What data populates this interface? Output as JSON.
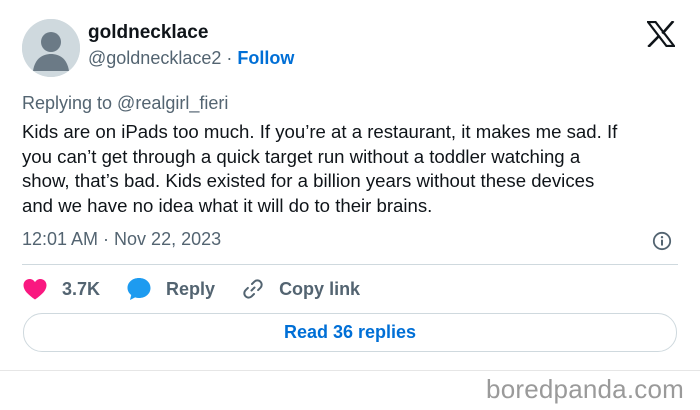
{
  "author": {
    "display_name": "goldnecklace",
    "handle": "@goldnecklace2",
    "separator": "·",
    "follow_label": "Follow"
  },
  "tweet": {
    "replying_to": "Replying to @realgirl_fieri",
    "text": "Kids are on iPads too much. If you’re at a restaurant, it makes me sad. If\nyou can’t get through a quick target run without a toddler watching a\nshow, that’s bad. Kids existed for a billion years without these devices\nand we have no idea what it will do to their brains.",
    "timestamp": "12:01 AM · Nov 22, 2023"
  },
  "actions": {
    "likes_count": "3.7K",
    "reply_label": "Reply",
    "copy_link_label": "Copy link",
    "read_replies_label": "Read 36 replies"
  },
  "icons": {
    "brand": "x-logo-icon",
    "info": "info-icon",
    "like": "heart-icon",
    "reply": "speech-bubble-icon",
    "copy": "link-icon"
  },
  "colors": {
    "link_blue": "#006fd6",
    "like_pink": "#f91880",
    "reply_blue": "#1d9bf0",
    "muted_text": "#536471"
  },
  "watermark": "boredpanda.com"
}
